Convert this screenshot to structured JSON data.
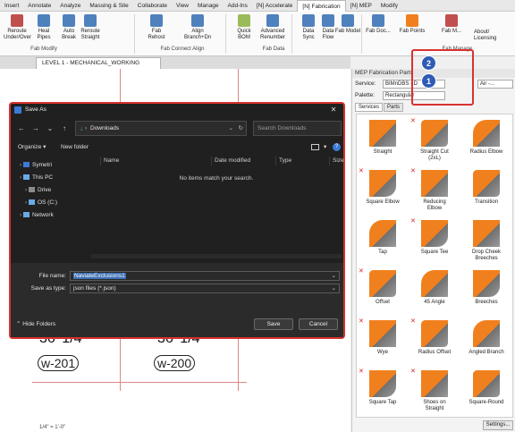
{
  "ribbon": {
    "tabs": [
      "Insert",
      "Annotate",
      "Analyze",
      "Massing & Site",
      "Collaborate",
      "View",
      "Manage",
      "Add-Ins",
      "[N] Accelerate",
      "[N] Fabrication",
      "[N] MEP",
      "Modify"
    ],
    "active_tab": "[N] Fabrication",
    "buttons": [
      {
        "label": "Reroute\nUnder/Over"
      },
      {
        "label": "Heal\nPipes"
      },
      {
        "label": "Auto\nBreak"
      },
      {
        "label": "Reroute\nStraight"
      },
      {
        "label": "Fab\nRehost"
      },
      {
        "label": "Align\nBranch+Dn"
      },
      {
        "label": "Quick BOM"
      },
      {
        "label": "Advanced\nRenumber"
      },
      {
        "label": "Data\nSync"
      },
      {
        "label": "Data\nFlow"
      },
      {
        "label": "Fab Model"
      },
      {
        "label": "Fab Doc..."
      },
      {
        "label": "Fab Points"
      },
      {
        "label": "Fab M..."
      }
    ],
    "groups": [
      "Fab Modify",
      "Fab Connect Align",
      "Fab Data",
      "Fab Manage"
    ],
    "about_label": "About/\nLicensing"
  },
  "view": {
    "tab_label": "LEVEL 1 - MECHANICAL_WORKING",
    "dims": [
      "36' 1/4",
      "36' 1/4"
    ],
    "tags": [
      "w-201",
      "w-200"
    ],
    "scale": "1/4\" = 1'-0\""
  },
  "mep": {
    "title": "MEP Fabrication Parts",
    "service_label": "Service:",
    "service_value": "BIMnDBS - D",
    "service2_value": "Air -...",
    "palette_label": "Palette:",
    "palette_value": "Rectangular",
    "tabs": [
      "Services",
      "Parts"
    ],
    "settings_label": "Settings...",
    "fittings": [
      {
        "name": "Straight",
        "x": false
      },
      {
        "name": "Straight Cut\n(2xL)",
        "x": true
      },
      {
        "name": "Radius Elbow",
        "x": false
      },
      {
        "name": "Square Elbow",
        "x": true
      },
      {
        "name": "Reducing\nElbow",
        "x": true
      },
      {
        "name": "Transition",
        "x": false
      },
      {
        "name": "Tap",
        "x": false
      },
      {
        "name": "Square Tee",
        "x": true
      },
      {
        "name": "Drop Cheek\nBreeches",
        "x": false
      },
      {
        "name": "Offset",
        "x": true
      },
      {
        "name": "45 Angle",
        "x": false
      },
      {
        "name": "Breeches",
        "x": false
      },
      {
        "name": "Wye",
        "x": true
      },
      {
        "name": "Radius Offset",
        "x": true
      },
      {
        "name": "Angled Branch",
        "x": false
      },
      {
        "name": "Square Tap",
        "x": true
      },
      {
        "name": "Shoes on\nStraight",
        "x": true
      },
      {
        "name": "Square-Round",
        "x": false
      }
    ]
  },
  "callouts": [
    "2",
    "1"
  ],
  "dialog": {
    "title": "Save As",
    "close": "✕",
    "address": "Downloads",
    "search_placeholder": "Search Downloads",
    "organize_label": "Organize ▾",
    "new_folder_label": "New folder",
    "nav_items": [
      "Symetri",
      "This PC",
      "Drive",
      "OS (C:)",
      "Network"
    ],
    "columns": [
      "Name",
      "Date modified",
      "Type",
      "Size"
    ],
    "empty_message": "No items match your search.",
    "filename_label": "File name:",
    "filename_value": "NaviateExclusions1",
    "savetype_label": "Save as type:",
    "savetype_value": "json files  (*.json)",
    "hide_folders_label": "Hide Folders",
    "save_label": "Save",
    "cancel_label": "Cancel"
  },
  "colors": {
    "accent": "#d9322f",
    "orange": "#f0801e",
    "badge": "#2f5bb7"
  }
}
